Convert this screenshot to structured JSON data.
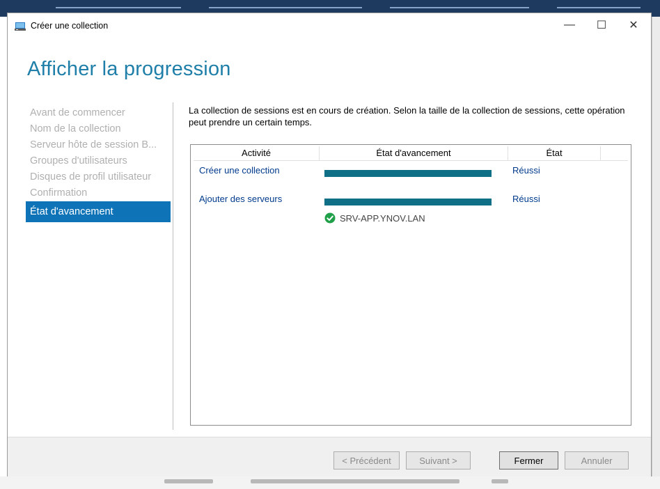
{
  "window": {
    "title": "Créer une collection",
    "minimize_glyph": "—",
    "maximize_glyph": "☐",
    "close_glyph": "✕",
    "icon": "server-manager-icon"
  },
  "page": {
    "title": "Afficher la progression",
    "description": "La collection de sessions est en cours de création. Selon la taille de la collection de sessions, cette opération peut prendre un certain temps."
  },
  "nav": {
    "items": [
      {
        "label": "Avant de commencer",
        "active": false
      },
      {
        "label": "Nom de la collection",
        "active": false
      },
      {
        "label": "Serveur hôte de session B...",
        "active": false
      },
      {
        "label": "Groupes d'utilisateurs",
        "active": false
      },
      {
        "label": "Disques de profil utilisateur",
        "active": false
      },
      {
        "label": "Confirmation",
        "active": false
      },
      {
        "label": "État d'avancement",
        "active": true
      }
    ]
  },
  "table": {
    "headers": {
      "activity": "Activité",
      "progress": "État d'avancement",
      "status": "État"
    },
    "rows": [
      {
        "activity": "Créer une collection",
        "progress": 1.0,
        "status": "Réussi"
      },
      {
        "activity": "Ajouter des serveurs",
        "progress": 1.0,
        "status": "Réussi",
        "server": "SRV-APP.YNOV.LAN"
      }
    ]
  },
  "footer": {
    "prev_label": "< Précédent",
    "next_label": "Suivant >",
    "close_label": "Fermer",
    "cancel_label": "Annuler"
  },
  "colors": {
    "accent": "#0f73b8",
    "title": "#1f7fa8",
    "progress_fill": "#0e6f87",
    "success": "#21a04a"
  }
}
